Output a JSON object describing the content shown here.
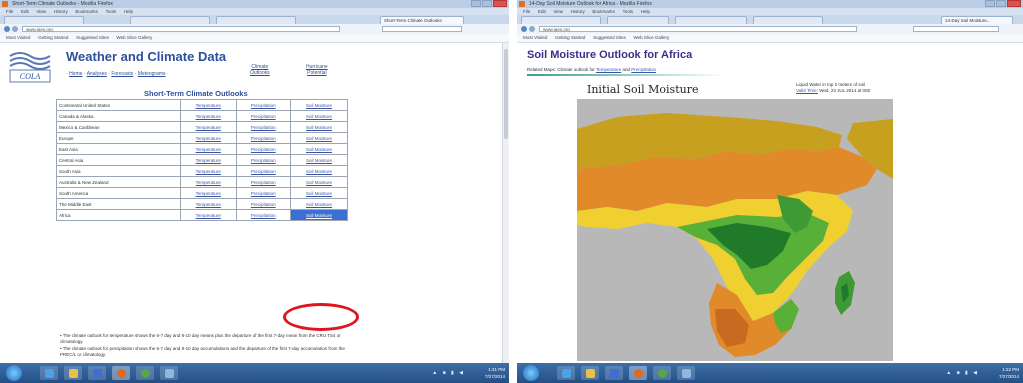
{
  "left": {
    "window_title": "Short-Term Climate Outlooks - Mozilla Firefox",
    "menu": [
      "File",
      "Edit",
      "View",
      "History",
      "Bookmarks",
      "Tools",
      "Help"
    ],
    "tabs": [
      "",
      "",
      "",
      "Short-Term Climate Outlooks"
    ],
    "address": "www.iges.org",
    "favorites": [
      "Most Visited",
      "Getting Started",
      "Suggested Sites",
      "Web Slice Gallery"
    ],
    "site_title": "Weather and Climate Data",
    "nav": [
      "Home",
      "Analyses",
      "Forecasts",
      "Meteograms"
    ],
    "nav_extra": [
      {
        "line1": "Climate",
        "line2": "Outlooks"
      },
      {
        "line1": "Hurricane",
        "line2": "Potential"
      }
    ],
    "section_title": "Short-Term Climate Outlooks",
    "regions": [
      {
        "name": "Continental United States",
        "temp": "Temperature",
        "precip": "Precipitation",
        "soil": "Soil Moisture"
      },
      {
        "name": "Canada & Alaska",
        "temp": "Temperature",
        "precip": "Precipitation",
        "soil": "Soil Moisture"
      },
      {
        "name": "Mexico & Caribbean",
        "temp": "Temperature",
        "precip": "Precipitation",
        "soil": "Soil Moisture"
      },
      {
        "name": "Europe",
        "temp": "Temperature",
        "precip": "Precipitation",
        "soil": "Soil Moisture"
      },
      {
        "name": "East Asia",
        "temp": "Temperature",
        "precip": "Precipitation",
        "soil": "Soil Moisture"
      },
      {
        "name": "Central Asia",
        "temp": "Temperature",
        "precip": "Precipitation",
        "soil": "Soil Moisture"
      },
      {
        "name": "South Asia",
        "temp": "Temperature",
        "precip": "Precipitation",
        "soil": "Soil Moisture"
      },
      {
        "name": "Australia & New Zealand",
        "temp": "Temperature",
        "precip": "Precipitation",
        "soil": "Soil Moisture"
      },
      {
        "name": "South America",
        "temp": "Temperature",
        "precip": "Precipitation",
        "soil": "Soil Moisture"
      },
      {
        "name": "The Middle East",
        "temp": "Temperature",
        "precip": "Precipitation",
        "soil": "Soil Moisture"
      },
      {
        "name": "Africa",
        "temp": "Temperature",
        "precip": "Precipitation",
        "soil": "Soil Moisture"
      }
    ],
    "notes": [
      "The climate outlook for temperature shows the 6-7 day and 8-10 day means plus the departure of the first 7-day mean from the CRU TS4 or climatology.",
      "The climate outlook for precipitation shows the 6-7 day and 8-10 day accumulations and the departure of the first 7-day accumulation from the PREC/L or climatology."
    ],
    "clock": {
      "time": "1:21 PM",
      "date": "7/27/2014"
    }
  },
  "right": {
    "window_title": "14-Day Soil Moisture Outlook for Africa - Mozilla Firefox",
    "menu": [
      "File",
      "Edit",
      "View",
      "History",
      "Bookmarks",
      "Tools",
      "Help"
    ],
    "tabs": [
      "",
      "",
      "",
      "",
      "14-Day Soil Moisture..."
    ],
    "address": "www.iges.org",
    "favorites": [
      "Most Visited",
      "Getting Started",
      "Suggested Sites",
      "Web Slice Gallery"
    ],
    "page_title": "Soil Moisture Outlook for Africa",
    "related_prefix": "Related Maps: Climate outlook for",
    "related_temp": "Temperature",
    "related_and": "and",
    "related_precip": "Precipitation",
    "map_title": "Initial Soil Moisture",
    "map_sub_line1": "Liquid Water in top 2 meters of soil",
    "map_sub_valid": "Valid Time:",
    "map_sub_date": "Wed, 23 JUL 2014 at 00Z",
    "clock": {
      "time": "1:22 PM",
      "date": "7/27/2014"
    }
  },
  "colors": {
    "accent": "#2e4f9c",
    "highlight": "#e0141e",
    "ocean": "#b8b8b8"
  }
}
